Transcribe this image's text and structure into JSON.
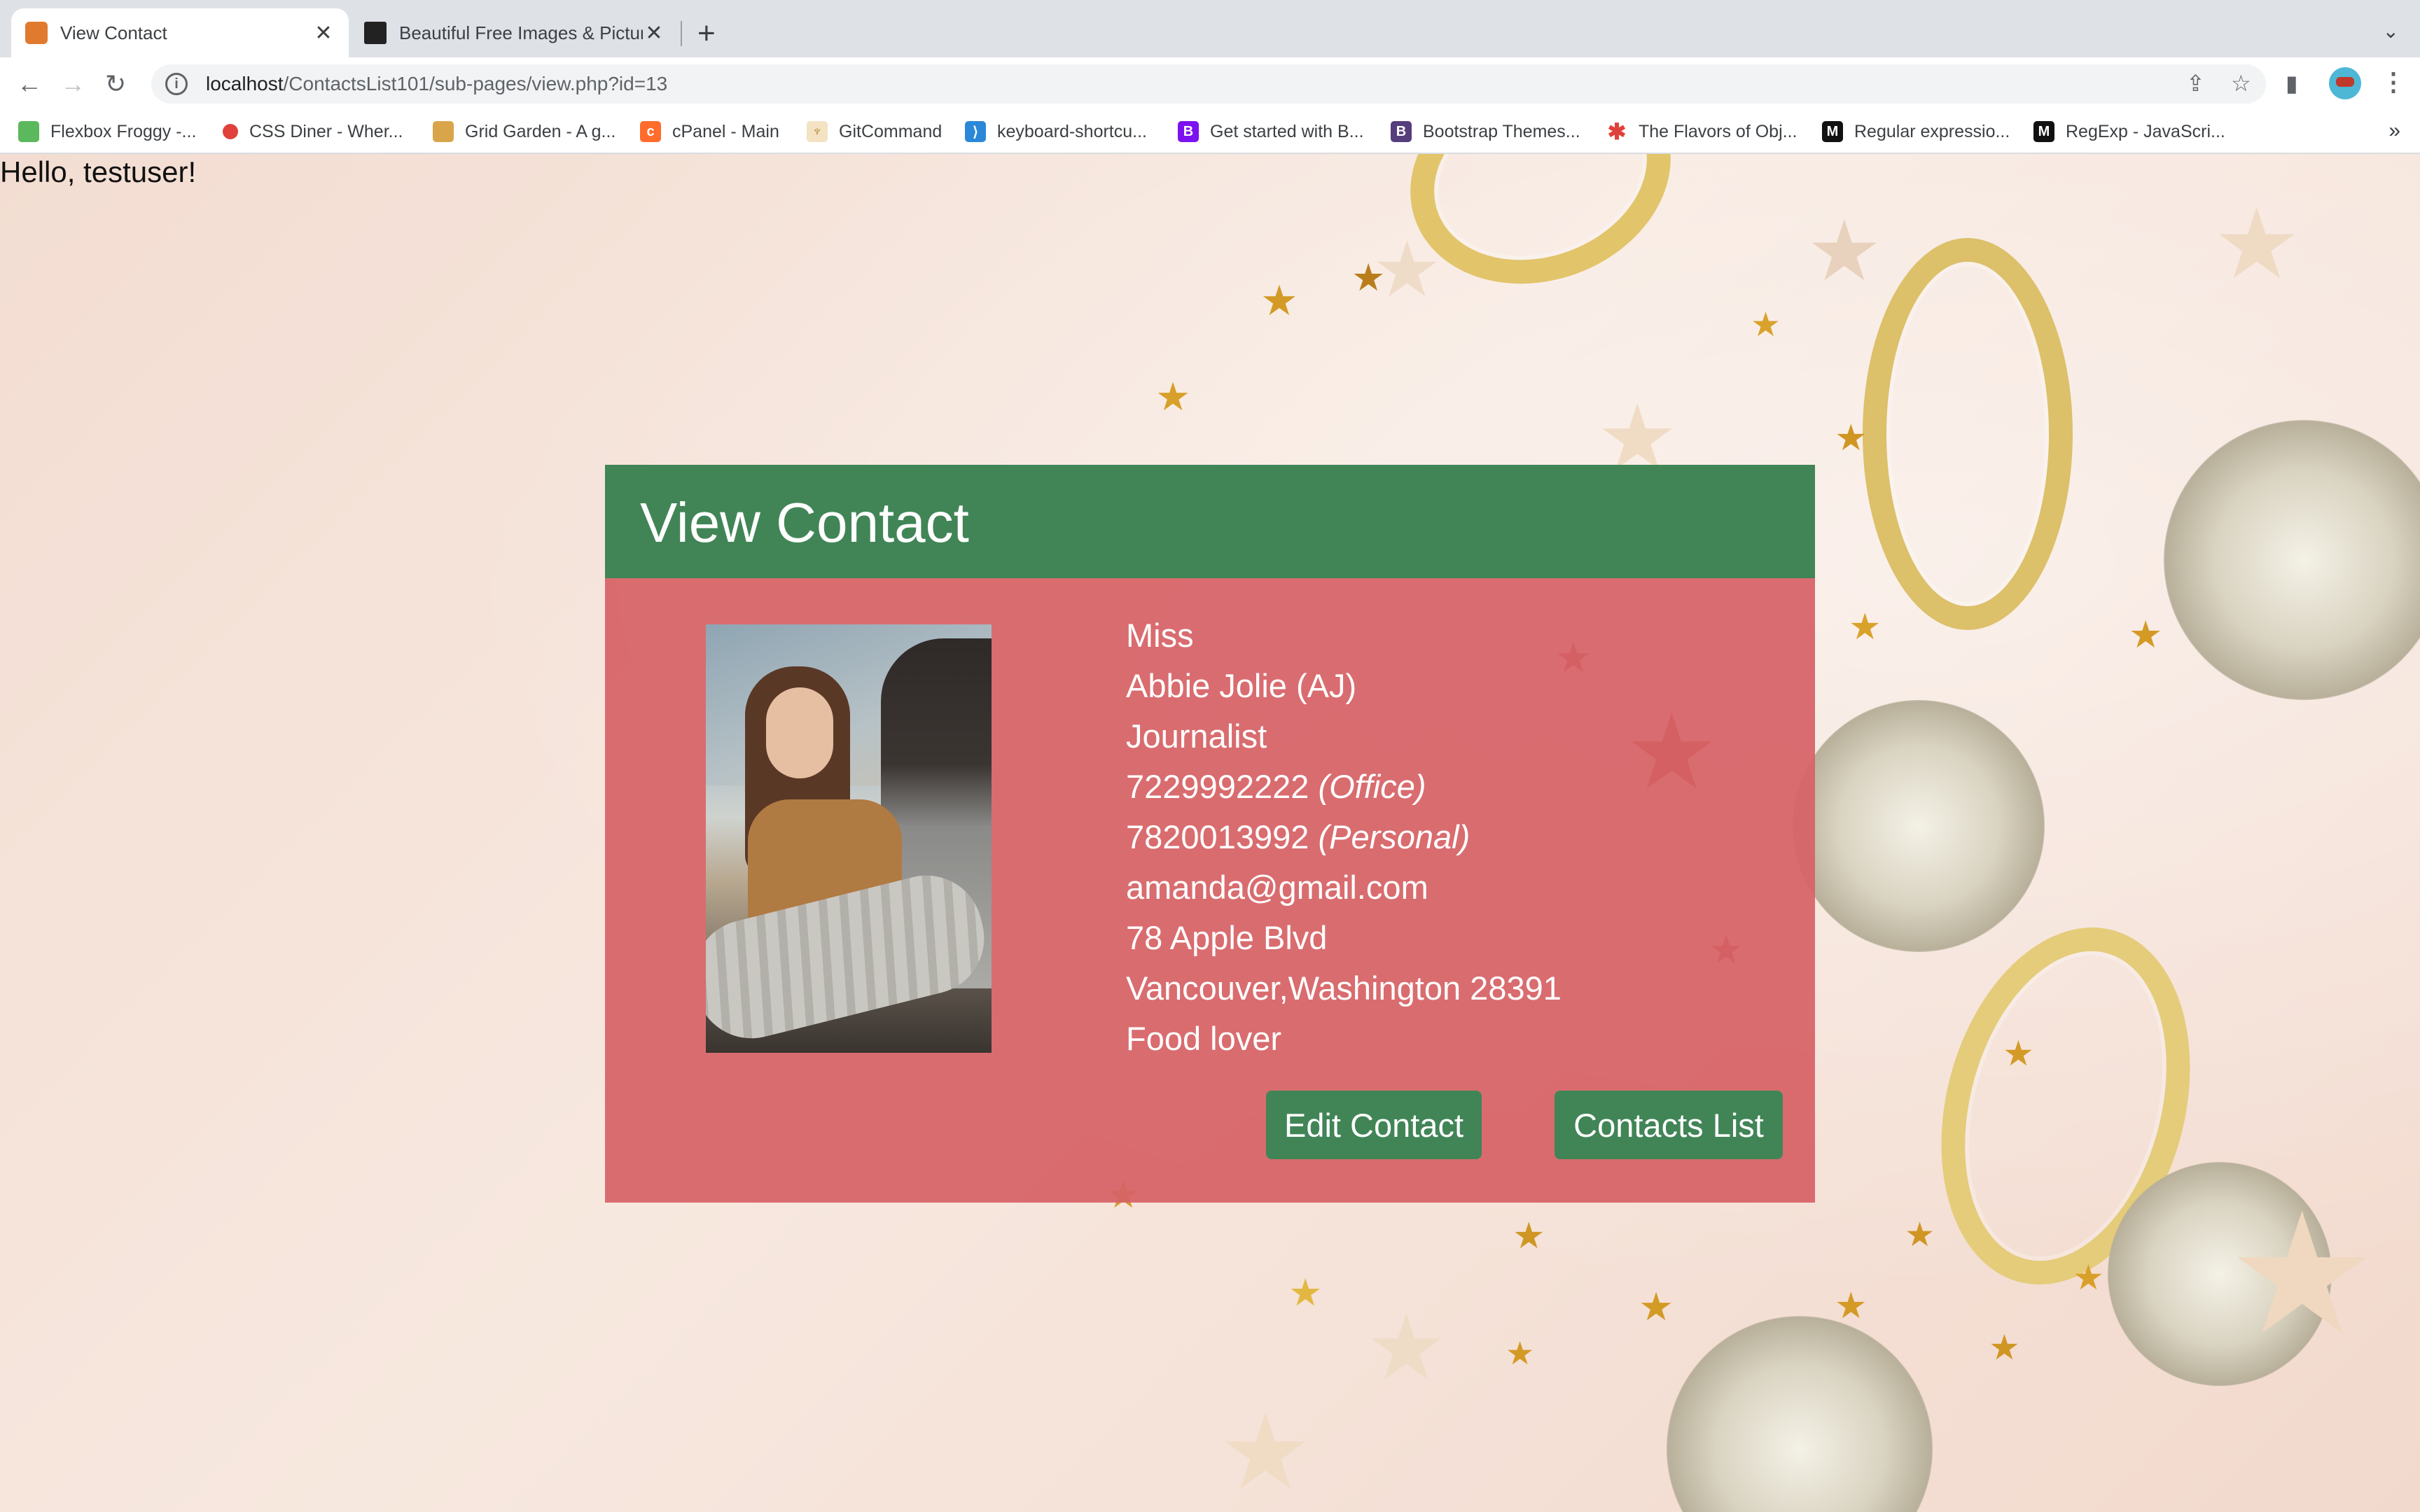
{
  "browser": {
    "tabs": [
      {
        "title": "View Contact",
        "active": true,
        "favicon": "xampp-icon"
      },
      {
        "title": "Beautiful Free Images & Pictures",
        "active": false,
        "favicon": "unsplash-icon"
      }
    ],
    "url_host": "localhost",
    "url_path": "/ContactsList101/sub-pages/view.php?id=13",
    "bookmarks": [
      {
        "label": "Flexbox Froggy -...",
        "icon": "frog-icon"
      },
      {
        "label": "CSS Diner - Wher...",
        "icon": "plate-icon"
      },
      {
        "label": "Grid Garden - A g...",
        "icon": "carrot-icon"
      },
      {
        "label": "cPanel - Main",
        "icon": "cpanel-icon"
      },
      {
        "label": "GitCommand",
        "icon": "git-icon"
      },
      {
        "label": "keyboard-shortcu...",
        "icon": "vscode-icon"
      },
      {
        "label": "Get started with B...",
        "icon": "bootstrap-icon"
      },
      {
        "label": "Bootstrap Themes...",
        "icon": "bootstrap-themes-icon"
      },
      {
        "label": "The Flavors of Obj...",
        "icon": "asterisk-icon"
      },
      {
        "label": "Regular expressio...",
        "icon": "mdn-icon"
      },
      {
        "label": "RegExp - JavaScri...",
        "icon": "mdn-icon"
      }
    ],
    "bookmarks_more": "»"
  },
  "page": {
    "greeting": "Hello, testuser!",
    "card_title": "View Contact",
    "contact": {
      "title": "Miss",
      "name": "Abbie Jolie (AJ)",
      "occupation": "Journalist",
      "phone_office": "7229992222",
      "phone_office_label": "(Office)",
      "phone_personal": "7820013992",
      "phone_personal_label": "(Personal)",
      "email": "amanda@gmail.com",
      "address": "78 Apple Blvd",
      "city_state_zip": "Vancouver,Washington 28391",
      "notes": "Food lover"
    },
    "buttons": {
      "edit": "Edit Contact",
      "list": "Contacts List"
    }
  },
  "colors": {
    "header_green": "#418557",
    "card_red": "#d66266",
    "text_white": "#ffffff"
  }
}
